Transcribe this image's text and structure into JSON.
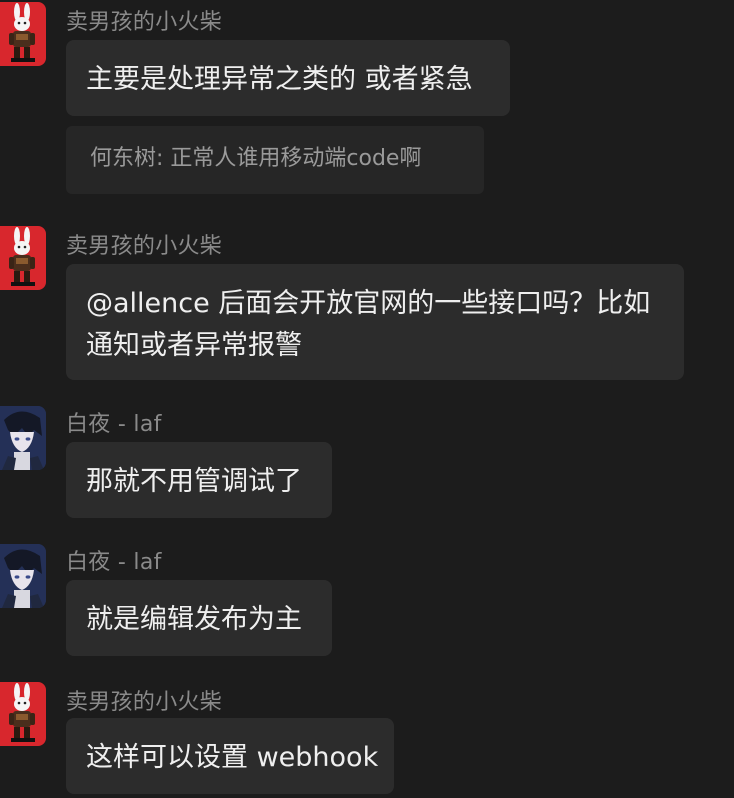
{
  "messages": [
    {
      "sender": "卖男孩的小火柴",
      "avatar_icon": "rabbit-robot-avatar-icon",
      "lines": [
        "主要是处理异常之类的 或者紧急"
      ],
      "quote": "何东树: 正常人谁用移动端code啊"
    },
    {
      "sender": "卖男孩的小火柴",
      "avatar_icon": "rabbit-robot-avatar-icon",
      "lines": [
        "@allence 后面会开放官网的一些接口吗？比如",
        "通知或者异常报警"
      ]
    },
    {
      "sender": "白夜 - laf",
      "avatar_icon": "anime-boy-avatar-icon",
      "lines": [
        "那就不用管调试了"
      ]
    },
    {
      "sender": "白夜 - laf",
      "avatar_icon": "anime-boy-avatar-icon",
      "lines": [
        "就是编辑发布为主"
      ]
    },
    {
      "sender": "卖男孩的小火柴",
      "avatar_icon": "rabbit-robot-avatar-icon",
      "lines": [
        "这样可以设置 webhook"
      ]
    }
  ],
  "colors": {
    "background": "#1c1c1c",
    "bubble": "#2c2c2c",
    "quote_bubble": "#262626",
    "sender_name": "#8a8a8a",
    "message_text": "#efefef",
    "avatar_red": "#d8272d",
    "avatar_blue": "#2e3f6e"
  }
}
